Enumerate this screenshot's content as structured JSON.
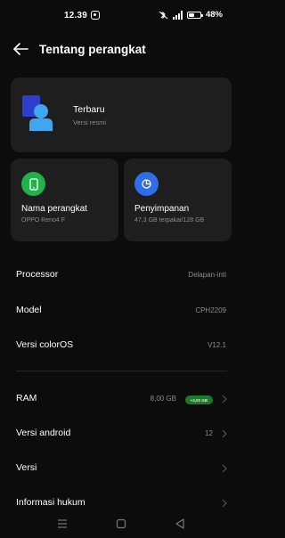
{
  "status_bar": {
    "time": "12.39",
    "battery_text": "48%",
    "battery_level": 0.48,
    "icons": [
      "notification-icon",
      "bluetooth-mute-icon",
      "signal-icon",
      "battery-icon"
    ]
  },
  "header": {
    "title": "Tentang perangkat",
    "back_icon": "arrow-left-icon"
  },
  "main_card": {
    "title": "Terbaru",
    "subtitle": "Versi resmi",
    "icon": "coloros-logo"
  },
  "device_card": {
    "title": "Nama perangkat",
    "subtitle": "OPPO Reno4 F",
    "icon": "phone-icon",
    "color": "#21b24a"
  },
  "storage_card": {
    "title": "Penyimpanan",
    "subtitle": "47,3 GB terpakai/128 GB",
    "icon": "pie-chart-icon",
    "color": "#2f6eea"
  },
  "info_rows": [
    {
      "label": "Processor",
      "value": "Delapan-inti"
    },
    {
      "label": "Model",
      "value": "CPH2209"
    },
    {
      "label": "Versi colorOS",
      "value": "V12.1"
    }
  ],
  "ram_row": {
    "label": "RAM",
    "value": "8,00 GB",
    "badge": "+3,00 GB"
  },
  "link_rows": [
    {
      "label": "Versi android",
      "value": "12"
    },
    {
      "label": "Versi",
      "value": ""
    },
    {
      "label": "Informasi hukum",
      "value": ""
    }
  ],
  "nav_bar": {
    "items": [
      "menu-icon",
      "home-icon",
      "back-icon"
    ]
  },
  "colors": {
    "background": "#0c0c0c",
    "card": "#1e1e1e",
    "secondary_text": "#8c8c8c",
    "badge_green": "#1a7a25"
  }
}
